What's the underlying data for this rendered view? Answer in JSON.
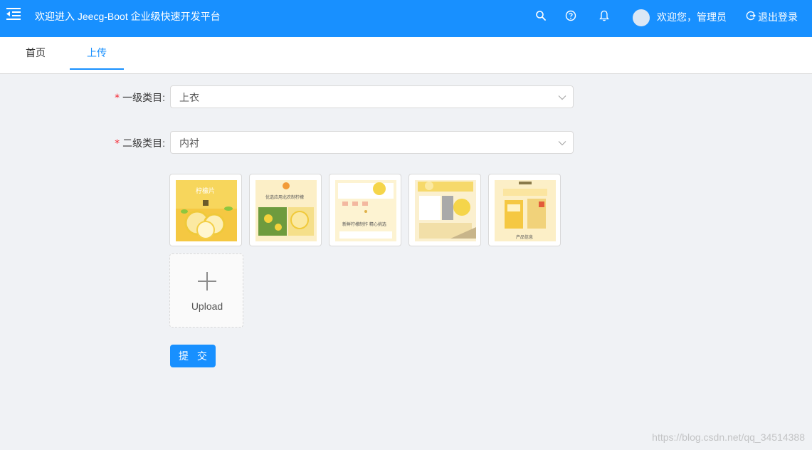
{
  "header": {
    "app_title": "欢迎进入 Jeecg-Boot 企业级快速开发平台",
    "welcome": "欢迎您，管理员",
    "logout_label": "退出登录",
    "brand_color": "#1890ff",
    "icons": [
      "menu-fold-icon",
      "search-icon",
      "help-icon",
      "bell-icon",
      "user-avatar",
      "logout-icon"
    ]
  },
  "tabs": [
    {
      "label": "首页",
      "active": false
    },
    {
      "label": "上传",
      "active": true
    }
  ],
  "form": {
    "category1": {
      "label": "一级类目:",
      "value": "上衣",
      "required": true
    },
    "category2": {
      "label": "二级类目:",
      "value": "内衬",
      "required": true
    },
    "uploaded_count": 5,
    "upload_label": "Upload",
    "submit_label": "提 交"
  },
  "thumbnails": [
    {
      "caption": "柠檬片"
    },
    {
      "caption": "优选应用北农制柠檬"
    },
    {
      "caption": "新鲜柠檬制作 精心挑选"
    },
    {
      "caption": ""
    },
    {
      "caption": "产品信息"
    }
  ],
  "watermark": "https://blog.csdn.net/qq_34514388"
}
